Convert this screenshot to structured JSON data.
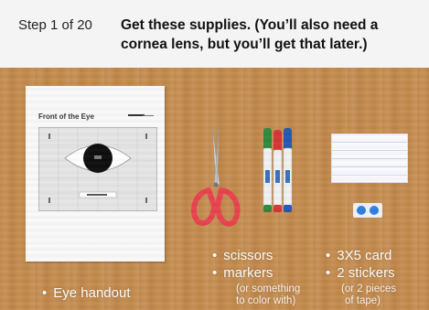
{
  "header": {
    "step": "Step 1 of 20",
    "instruction": "Get these supplies. (You’ll also need a cornea lens, but you’ll get that later.)"
  },
  "handout": {
    "title": "Front of the Eye"
  },
  "labels": {
    "handout": "Eye handout",
    "scissors": "scissors",
    "markers": "markers",
    "markers_note_1": "(or something",
    "markers_note_2": "to color with)",
    "card": "3X5 card",
    "stickers": "2 stickers",
    "stickers_note_1": "(or 2 pieces",
    "stickers_note_2": "of tape)"
  },
  "colors": {
    "header_bg": "#f4f4f4",
    "table_wood": "#c38a4d",
    "scissor_handle": "#e8424f",
    "marker_green": "#2f8a3c",
    "marker_red": "#d8343a",
    "marker_blue": "#2357b8",
    "sticker_blue": "#2f7fe0"
  }
}
